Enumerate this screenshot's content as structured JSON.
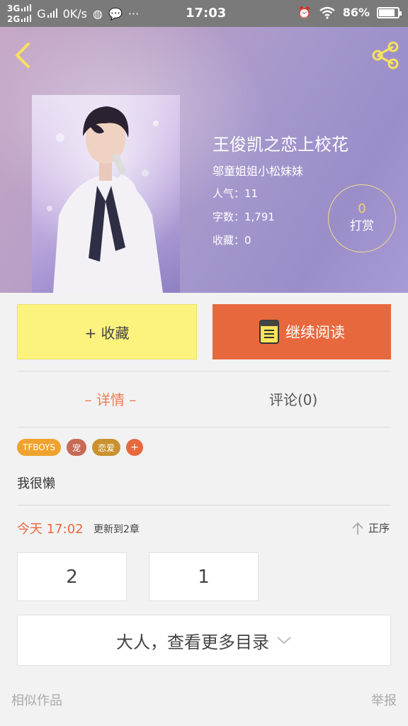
{
  "status_bar": {
    "network_top": "3G",
    "network_bottom": "2G",
    "carrier": "G",
    "speed": "0K/s",
    "more": "···",
    "time": "17:03",
    "battery_percent": "86%",
    "battery_level": 0.86
  },
  "hero": {
    "title": "王俊凯之恋上校花",
    "author": "邬童姐姐小松妹妹",
    "popularity": "人气：11",
    "word_count": "字数：1,791",
    "favorites": "收藏：0",
    "tip_count": "0",
    "tip_label": "打赏"
  },
  "actions": {
    "collect_label": "+ 收藏",
    "read_label": "继续阅读"
  },
  "tabs": {
    "detail": "– 详情 –",
    "comments": "评论(0)"
  },
  "tags": [
    {
      "label": "TFBOYS",
      "color": "#f0a22e"
    },
    {
      "label": "宠",
      "color": "#c76b55"
    },
    {
      "label": "恋爱",
      "color": "#c9912f"
    },
    {
      "label": "+",
      "color": "#e8683d"
    }
  ],
  "intro": "我很懒",
  "updates": {
    "time": "今天 17:02",
    "text": "更新到2章",
    "sort_label": "正序"
  },
  "chapters": [
    "2",
    "1"
  ],
  "more_toc": "大人，查看更多目录",
  "footer": {
    "similar": "相似作品",
    "report": "举报"
  },
  "colors": {
    "accent": "#e8683d",
    "collect_bg": "#fbf37d",
    "tip_ring": "#f1d989"
  }
}
